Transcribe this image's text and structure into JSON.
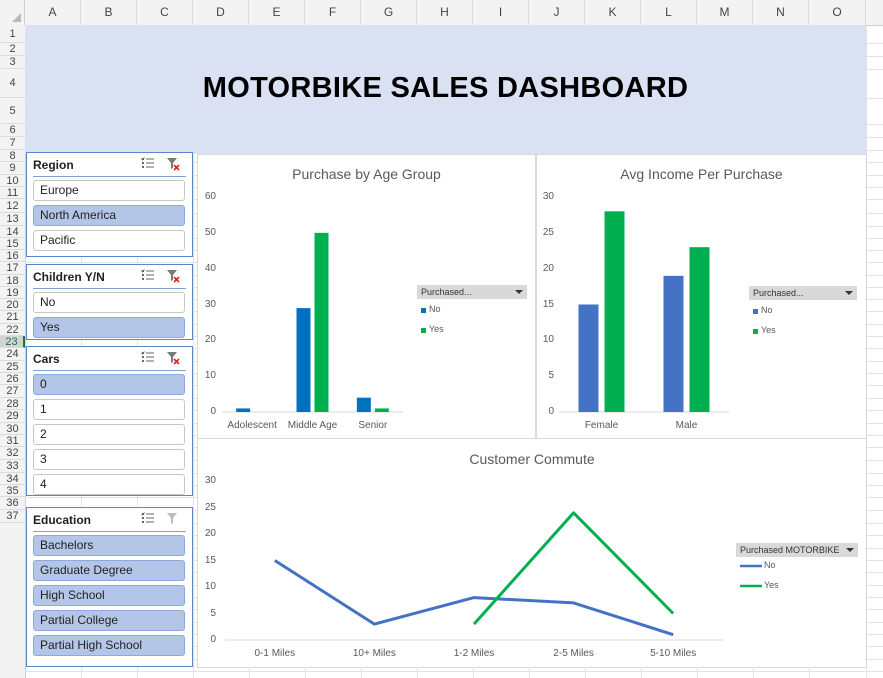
{
  "columns": [
    "A",
    "B",
    "C",
    "D",
    "E",
    "F",
    "G",
    "H",
    "I",
    "J",
    "K",
    "L",
    "M",
    "N",
    "O"
  ],
  "rows": [
    "1",
    "2",
    "3",
    "4",
    "5",
    "6",
    "7",
    "8",
    "9",
    "10",
    "11",
    "12",
    "13",
    "14",
    "15",
    "16",
    "17",
    "18",
    "19",
    "20",
    "21",
    "22",
    "23",
    "24",
    "25",
    "26",
    "27",
    "28",
    "29",
    "30",
    "31",
    "32",
    "33",
    "34",
    "35",
    "36",
    "37"
  ],
  "selected_row": "23",
  "dashboard_title": "MOTORBIKE SALES DASHBOARD",
  "slicers": {
    "region": {
      "title": "Region",
      "items": [
        {
          "label": "Europe",
          "selected": false
        },
        {
          "label": "North America",
          "selected": true
        },
        {
          "label": "Pacific",
          "selected": false
        }
      ]
    },
    "children": {
      "title": "Children Y/N",
      "items": [
        {
          "label": "No",
          "selected": false
        },
        {
          "label": "Yes",
          "selected": true
        }
      ]
    },
    "cars": {
      "title": "Cars",
      "items": [
        {
          "label": "0",
          "selected": true
        },
        {
          "label": "1",
          "selected": false
        },
        {
          "label": "2",
          "selected": false
        },
        {
          "label": "3",
          "selected": false
        },
        {
          "label": "4",
          "selected": false
        }
      ]
    },
    "education": {
      "title": "Education",
      "items": [
        {
          "label": "Bachelors",
          "selected": true
        },
        {
          "label": "Graduate Degree",
          "selected": true
        },
        {
          "label": "High School",
          "selected": true
        },
        {
          "label": "Partial College",
          "selected": true
        },
        {
          "label": "Partial High School",
          "selected": true
        }
      ]
    }
  },
  "icons": [
    "multi-select-icon",
    "clear-filter-icon"
  ],
  "colors": {
    "no": "#0070c0",
    "no_income": "#4472c4",
    "yes": "#00b050",
    "banner": "#d9e1f2",
    "selected_item": "#b4c6e7"
  },
  "chart_data": [
    {
      "type": "bar",
      "title": "Purchase by Age Group",
      "categories": [
        "Adolescent",
        "Middle Age",
        "Senior"
      ],
      "series": [
        {
          "name": "No",
          "values": [
            1,
            29,
            4
          ]
        },
        {
          "name": "Yes",
          "values": [
            0,
            50,
            1
          ]
        }
      ],
      "ylim": [
        0,
        60
      ],
      "yticks": [
        "0",
        "10",
        "20",
        "30",
        "40",
        "50",
        "60"
      ],
      "legend_title": "Purchased...",
      "legend": [
        "No",
        "Yes"
      ]
    },
    {
      "type": "bar",
      "title": "Avg Income Per Purchase",
      "categories": [
        "Female",
        "Male"
      ],
      "series": [
        {
          "name": "No",
          "values": [
            15,
            19
          ]
        },
        {
          "name": "Yes",
          "values": [
            28,
            23
          ]
        }
      ],
      "ylim": [
        0,
        30
      ],
      "yticks": [
        "0",
        "5",
        "10",
        "15",
        "20",
        "25",
        "30"
      ],
      "legend_title": "Purchased...",
      "legend": [
        "No",
        "Yes"
      ]
    },
    {
      "type": "line",
      "title": "Customer Commute",
      "categories": [
        "0-1 Miles",
        "10+ Miles",
        "1-2 Miles",
        "2-5 Miles",
        "5-10 Miles"
      ],
      "series": [
        {
          "name": "No",
          "values": [
            15,
            3,
            8,
            7,
            1
          ]
        },
        {
          "name": "Yes",
          "values": [
            null,
            null,
            3,
            24,
            5
          ]
        }
      ],
      "ylim": [
        0,
        30
      ],
      "yticks": [
        "0",
        "5",
        "10",
        "15",
        "20",
        "25",
        "30"
      ],
      "legend_title": "Purchased MOTORBIKE",
      "legend": [
        "No",
        "Yes"
      ]
    }
  ]
}
